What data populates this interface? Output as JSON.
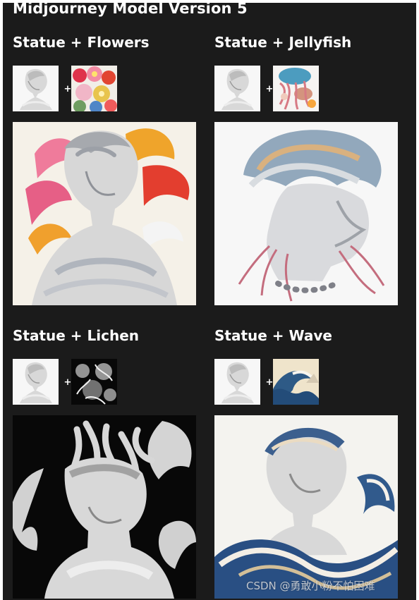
{
  "title": "Midjourney Model Version 5",
  "cards": [
    {
      "heading": "Statue + Flowers",
      "plus": "+",
      "source_icon": "statue-bust-thumbnail",
      "target_icon": "flowers-thumbnail",
      "result_icon": "statue-with-flowers-result",
      "accent": "#e84a3b"
    },
    {
      "heading": "Statue + Jellyfish",
      "plus": "+",
      "source_icon": "statue-bust-thumbnail",
      "target_icon": "jellyfish-thumbnail",
      "result_icon": "statue-jellyfish-result",
      "accent": "#b96b8d"
    },
    {
      "heading": "Statue + Lichen",
      "plus": "+",
      "source_icon": "statue-bust-thumbnail",
      "target_icon": "lichen-thumbnail",
      "result_icon": "statue-lichen-result",
      "accent": "#a7a7a7"
    },
    {
      "heading": "Statue + Wave",
      "plus": "+",
      "source_icon": "statue-bust-thumbnail",
      "target_icon": "wave-thumbnail",
      "result_icon": "statue-wave-result",
      "accent": "#3f6d9c"
    }
  ],
  "watermark": "CSDN @勇敢小粉不怕困难",
  "colors": {
    "panel_background": "#1b1b1b",
    "text": "#ffffff"
  }
}
